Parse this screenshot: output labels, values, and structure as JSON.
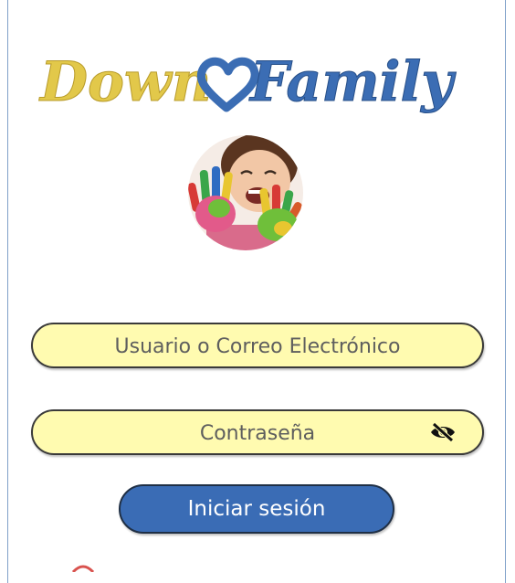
{
  "app": {
    "logo": {
      "text_down": "Down",
      "text_family": "Family",
      "colors": {
        "down": "#e2c84a",
        "heart": "#3b6db4",
        "family": "#3b6db4"
      }
    },
    "photo_alt": "child-with-painted-hands"
  },
  "form": {
    "username": {
      "placeholder": "Usuario o Correo Electrónico",
      "value": ""
    },
    "password": {
      "placeholder": "Contraseña",
      "value": ""
    },
    "login_label": "Iniciar sesión"
  },
  "colors": {
    "field_bg": "#fffbb0",
    "button_bg": "#3a6cb5",
    "frame_border": "#7fa0c9"
  }
}
